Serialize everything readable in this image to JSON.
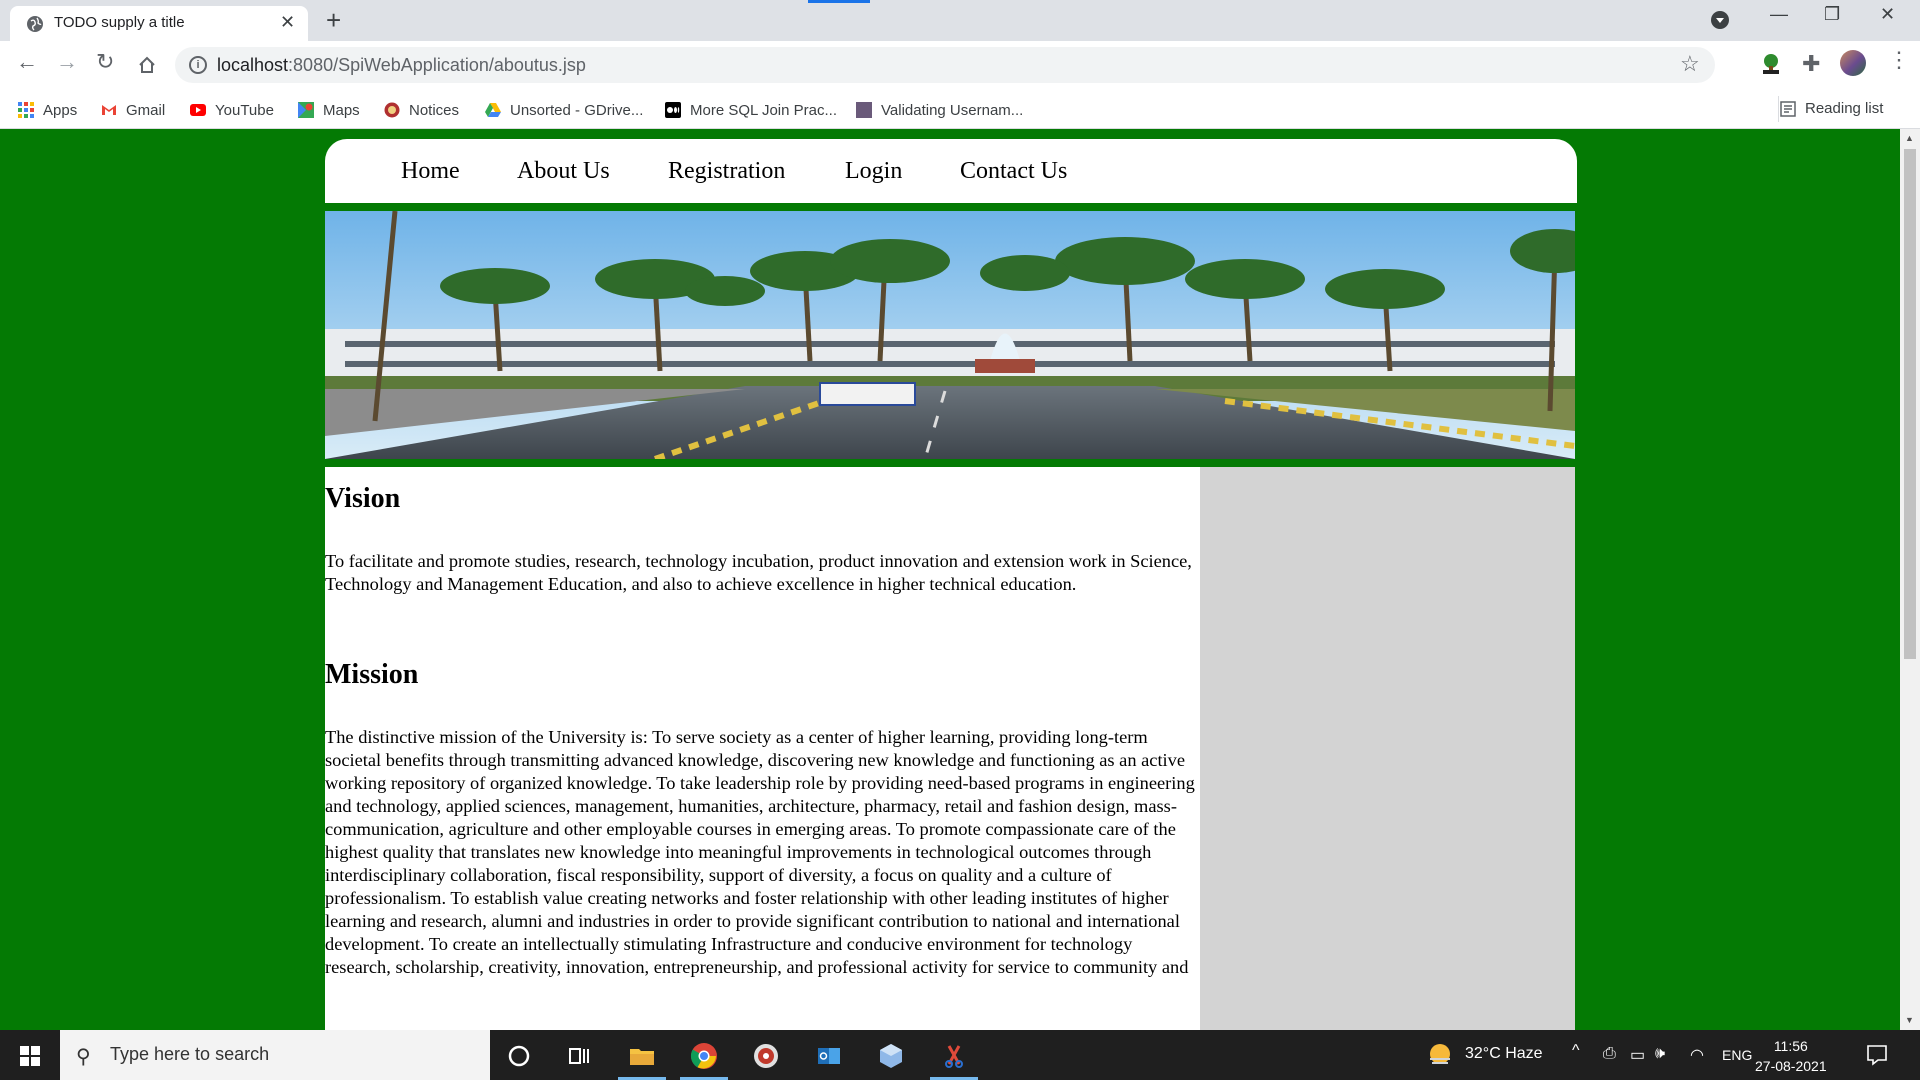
{
  "browser": {
    "tab_title": "TODO supply a title",
    "url_host": "localhost",
    "url_rest": ":8080/SpiWebApplication/aboutus.jsp",
    "bookmarks": [
      "Apps",
      "Gmail",
      "YouTube",
      "Maps",
      "Notices",
      "Unsorted - GDrive...",
      "More SQL Join Prac...",
      "Validating Usernam..."
    ],
    "reading_list": "Reading list"
  },
  "site": {
    "nav": [
      "Home",
      "About Us",
      "Registration",
      "Login",
      "Contact Us"
    ],
    "vision_heading": "Vision",
    "vision_text": "To facilitate and promote studies, research, technology incubation, product innovation and extension work in Science, Technology and Management Education, and also to achieve excellence in higher technical education.",
    "mission_heading": "Mission",
    "mission_text": "The distinctive mission of the University is: To serve society as a center of higher learning, providing long-term societal benefits through transmitting advanced knowledge, discovering new knowledge and functioning as an active working repository of organized knowledge. To take leadership role by providing need-based programs in engineering and technology, applied sciences, management, humanities, architecture, pharmacy, retail and fashion design, mass-communication, agriculture and other employable courses in emerging areas. To promote compassionate care of the highest quality that translates new knowledge into meaningful improvements in technological outcomes through interdisciplinary collaboration, fiscal responsibility, support of diversity, a focus on quality and a culture of professionalism. To establish value creating networks and foster relationship with other leading institutes of higher learning and research, alumni and industries in order to provide significant contribution to national and international development. To create an intellectually stimulating Infrastructure and conducive environment for technology research, scholarship, creativity, innovation, entrepreneurship, and professional activity for service to community and"
  },
  "taskbar": {
    "search_placeholder": "Type here to search",
    "weather": "32°C  Haze",
    "language": "ENG",
    "time": "11:56",
    "date": "27-08-2021"
  },
  "colors": {
    "page_background": "#047a04",
    "sidebar": "#d3d3d3"
  }
}
